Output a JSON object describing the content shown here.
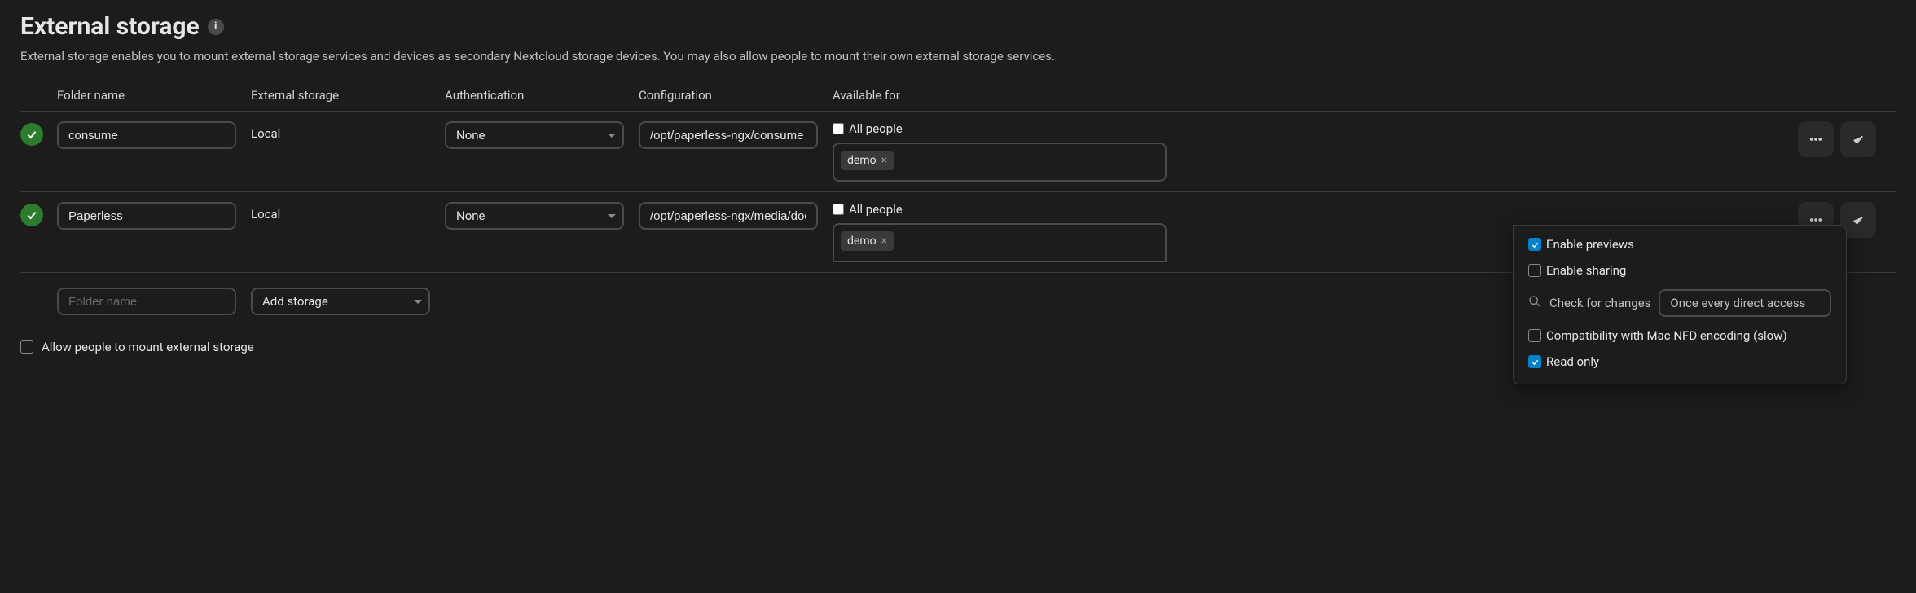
{
  "title": "External storage",
  "description": "External storage enables you to mount external storage services and devices as secondary Nextcloud storage devices. You may also allow people to mount their own external storage services.",
  "columns": {
    "folder": "Folder name",
    "storage": "External storage",
    "auth": "Authentication",
    "config": "Configuration",
    "avail": "Available for"
  },
  "rows": [
    {
      "folder": "consume",
      "type": "Local",
      "auth": "None",
      "config": "/opt/paperless-ngx/consume",
      "all_people": "All people",
      "tag": "demo"
    },
    {
      "folder": "Paperless",
      "type": "Local",
      "auth": "None",
      "config": "/opt/paperless-ngx/media/documents",
      "all_people": "All people",
      "tag": "demo"
    }
  ],
  "add": {
    "folder_placeholder": "Folder name",
    "storage_placeholder": "Add storage"
  },
  "popup": {
    "previews": "Enable previews",
    "sharing": "Enable sharing",
    "check_changes": "Check for changes",
    "frequency": "Once every direct access",
    "mac": "Compatibility with Mac NFD encoding (slow)",
    "readonly": "Read only"
  },
  "allow_people": "Allow people to mount external storage"
}
